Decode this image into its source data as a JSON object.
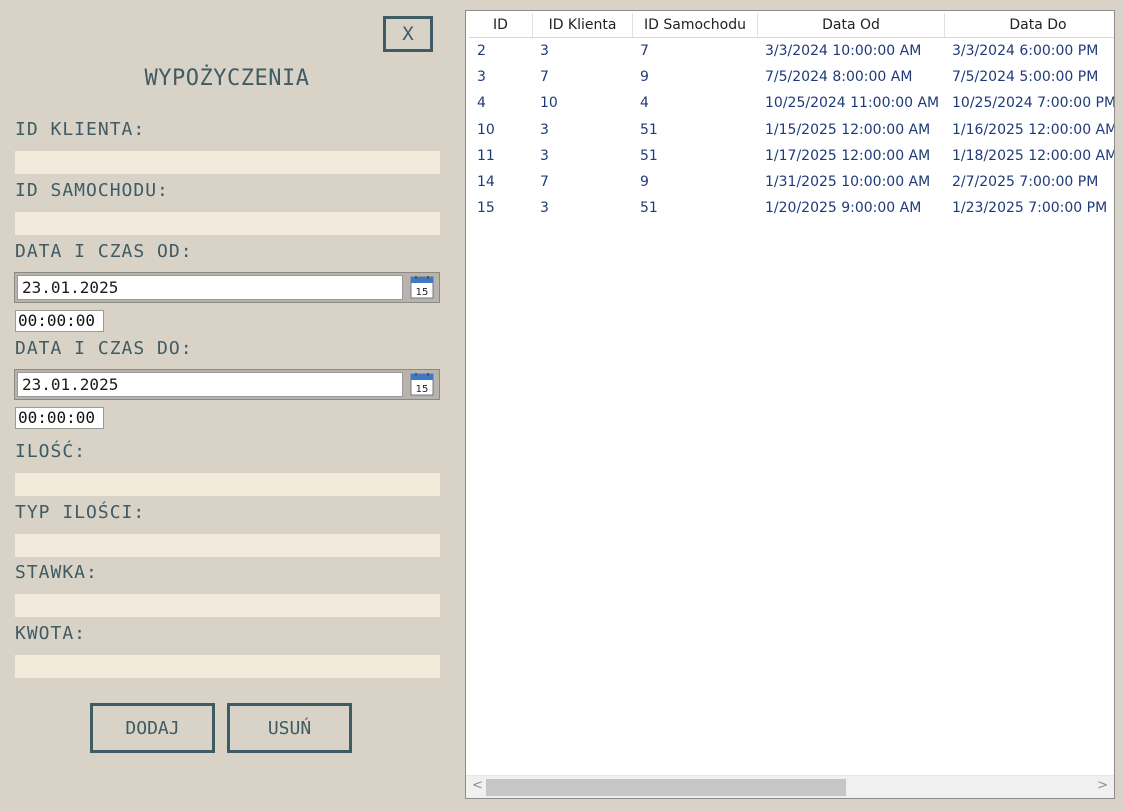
{
  "close_label": "X",
  "title": "WYPOŻYCZENIA",
  "form": {
    "id_klienta_label": "ID KLIENTA:",
    "id_klienta_value": "",
    "id_samochodu_label": "ID SAMOCHODU:",
    "id_samochodu_value": "",
    "data_od_label": "DATA I CZAS OD:",
    "data_od_date": "23.01.2025",
    "data_od_time": "00:00:00",
    "data_do_label": "DATA I CZAS DO:",
    "data_do_date": "23.01.2025",
    "data_do_time": "00:00:00",
    "calendar_day": "15",
    "ilosc_label": "ILOŚĆ:",
    "ilosc_value": "",
    "typ_ilosci_label": "TYP ILOŚCI:",
    "typ_ilosci_value": "",
    "stawka_label": "STAWKA:",
    "stawka_value": "",
    "kwota_label": "KWOTA:",
    "kwota_value": ""
  },
  "buttons": {
    "add": "DODAJ",
    "delete": "USUŃ"
  },
  "grid": {
    "columns": [
      "ID",
      "ID Klienta",
      "ID Samochodu",
      "Data Od",
      "Data Do"
    ],
    "rows": [
      [
        "2",
        "3",
        "7",
        "3/3/2024 10:00:00 AM",
        "3/3/2024 6:00:00 PM"
      ],
      [
        "3",
        "7",
        "9",
        "7/5/2024 8:00:00 AM",
        "7/5/2024 5:00:00 PM"
      ],
      [
        "4",
        "10",
        "4",
        "10/25/2024 11:00:00 AM",
        "10/25/2024 7:00:00 PM"
      ],
      [
        "10",
        "3",
        "51",
        "1/15/2025 12:00:00 AM",
        "1/16/2025 12:00:00 AM"
      ],
      [
        "11",
        "3",
        "51",
        "1/17/2025 12:00:00 AM",
        "1/18/2025 12:00:00 AM"
      ],
      [
        "14",
        "7",
        "9",
        "1/31/2025 10:00:00 AM",
        "2/7/2025 7:00:00 PM"
      ],
      [
        "15",
        "3",
        "51",
        "1/20/2025 9:00:00 AM",
        "1/23/2025 7:00:00 PM"
      ]
    ],
    "scroll_left": "<",
    "scroll_right": ">"
  },
  "colors": {
    "background": "#d9d2c6",
    "accent": "#3f5b63",
    "field": "#f2ebdc",
    "grid_text": "#1f3a7a"
  }
}
